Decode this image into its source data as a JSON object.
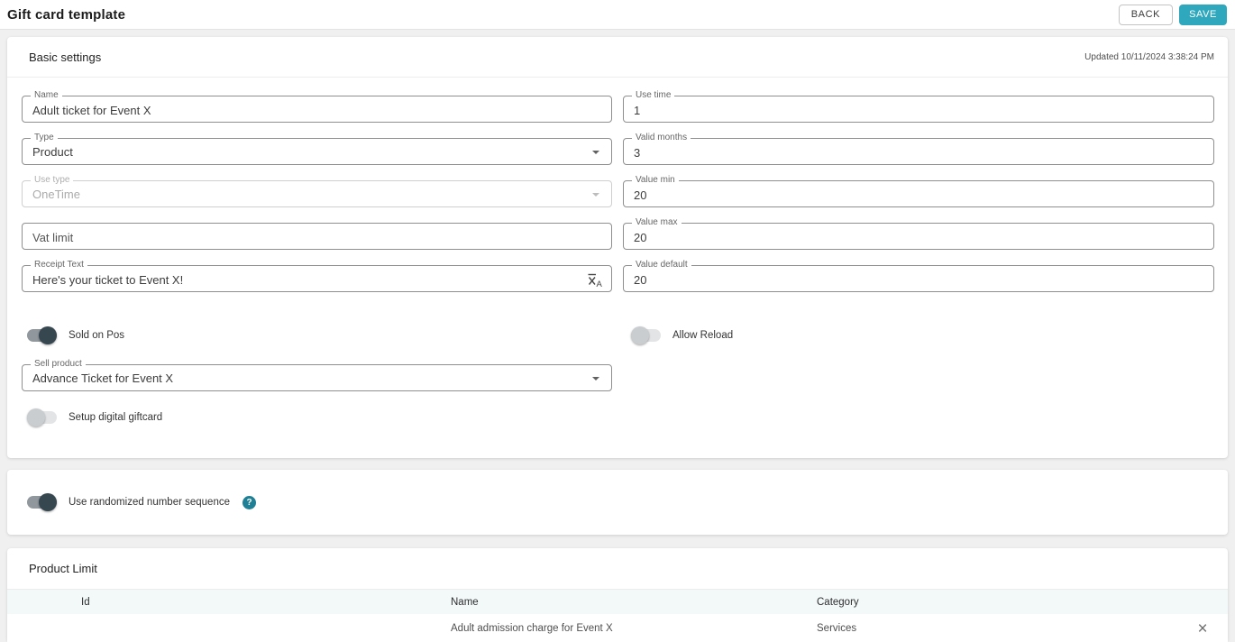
{
  "header": {
    "title": "Gift card template",
    "back_label": "BACK",
    "save_label": "SAVE"
  },
  "colors": {
    "accent": "#2fa8be",
    "toggle_on": "#37474f",
    "help_icon_bg": "#1e7f95",
    "table_header_bg": "#f3f8f9"
  },
  "icons": {
    "help_glyph": "?",
    "close_glyph": "×",
    "translate": "translate-icon",
    "chevron": "chevron-down-icon"
  },
  "basic_settings": {
    "title": "Basic settings",
    "updated": "Updated 10/11/2024 3:38:24 PM",
    "fields": {
      "name": {
        "label": "Name",
        "value": "Adult ticket for Event X"
      },
      "use_time": {
        "label": "Use time",
        "value": "1"
      },
      "type": {
        "label": "Type",
        "value": "Product"
      },
      "valid_months": {
        "label": "Valid months",
        "value": "3"
      },
      "use_type": {
        "label": "Use type",
        "value": "OneTime",
        "disabled": true
      },
      "value_min": {
        "label": "Value min",
        "value": "20"
      },
      "vat_limit": {
        "placeholder": "Vat limit",
        "value": ""
      },
      "value_max": {
        "label": "Value max",
        "value": "20"
      },
      "receipt_text": {
        "label": "Receipt Text",
        "value": "Here's your ticket to Event X!"
      },
      "value_default": {
        "label": "Value default",
        "value": "20"
      },
      "sell_product": {
        "label": "Sell product",
        "value": "Advance Ticket for Event X"
      }
    },
    "toggles": {
      "sold_on_pos": {
        "label": "Sold on Pos",
        "on": true
      },
      "allow_reload": {
        "label": "Allow Reload",
        "on": false
      },
      "setup_digital_giftcard": {
        "label": "Setup digital giftcard",
        "on": false
      }
    }
  },
  "randomized_section": {
    "label": "Use randomized number sequence",
    "on": true
  },
  "product_limit": {
    "title": "Product Limit",
    "columns": {
      "id": "Id",
      "name": "Name",
      "category": "Category"
    },
    "rows": [
      {
        "id": "",
        "name": "Adult admission charge for Event X",
        "category": "Services"
      }
    ]
  }
}
